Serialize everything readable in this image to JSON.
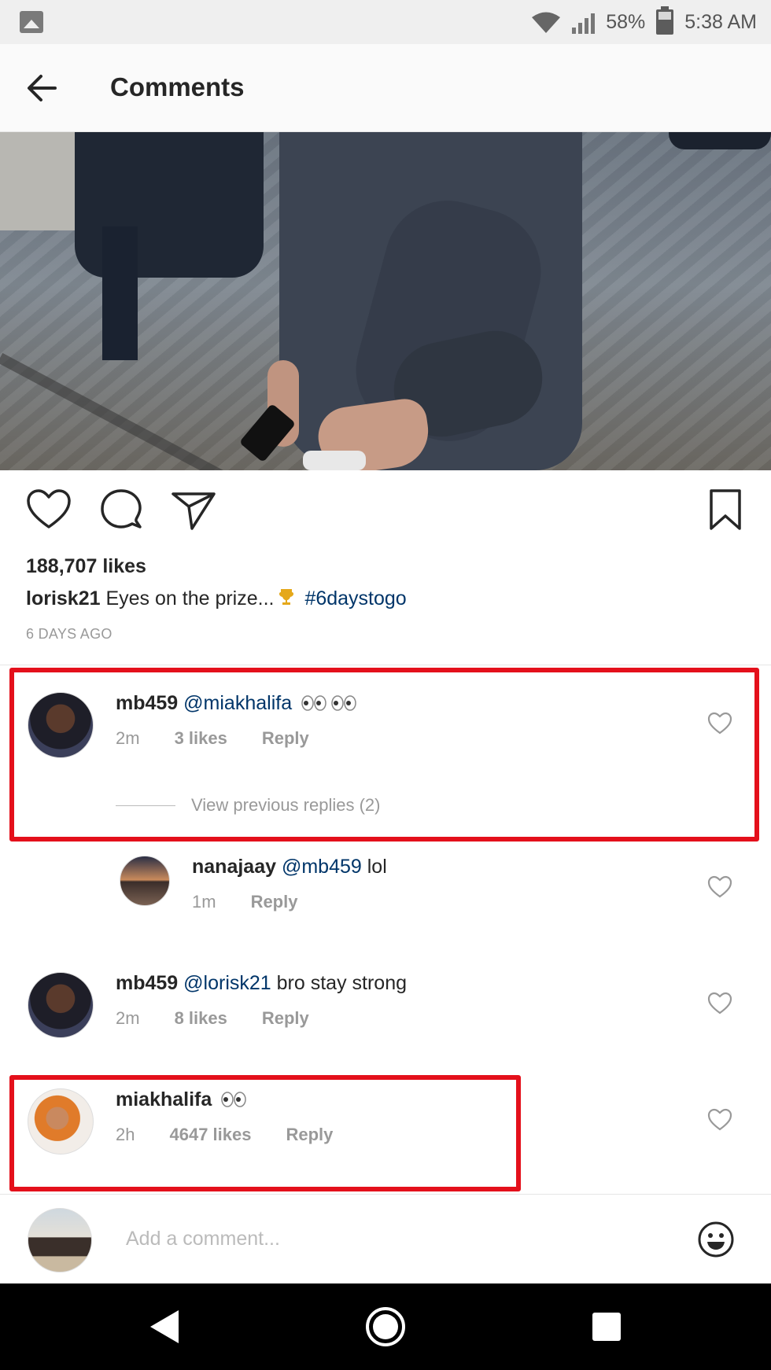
{
  "status_bar": {
    "battery": "58%",
    "time": "5:38 AM"
  },
  "header": {
    "title": "Comments"
  },
  "post": {
    "likes": "188,707 likes",
    "caption_user": "lorisk21",
    "caption_text": "Eyes on the prize...",
    "caption_hashtag": "#6daystogo",
    "time_ago": "6 DAYS AGO"
  },
  "comments": [
    {
      "user": "mb459",
      "mention": "@miakhalifa",
      "text": "",
      "time": "2m",
      "likes": "3 likes",
      "reply": "Reply",
      "view_previous": "View previous replies (2)"
    },
    {
      "user": "nanajaay",
      "mention": "@mb459",
      "text": "lol",
      "time": "1m",
      "reply": "Reply"
    },
    {
      "user": "mb459",
      "mention": "@lorisk21",
      "text": "bro stay strong",
      "time": "2m",
      "likes": "8 likes",
      "reply": "Reply"
    },
    {
      "user": "miakhalifa",
      "mention": "",
      "text": "",
      "time": "2h",
      "likes": "4647 likes",
      "reply": "Reply"
    }
  ],
  "comment_input": {
    "placeholder": "Add a comment..."
  },
  "colors": {
    "highlight": "#e4101b",
    "link": "#003569",
    "muted": "#999999"
  }
}
